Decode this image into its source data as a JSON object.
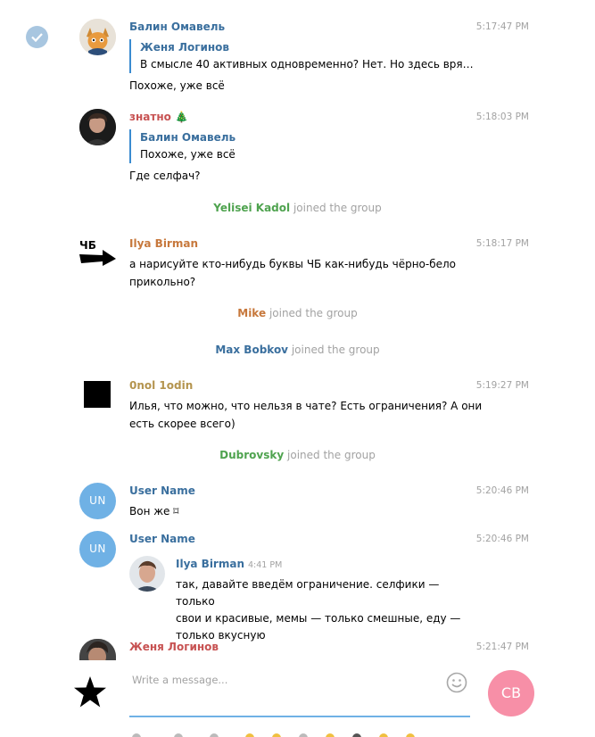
{
  "messages": [
    {
      "author": "Балин Омавель",
      "time": "5:17:47 PM",
      "reply_name": "Женя Логинов",
      "reply_text": "В смысле 40 активных одновременно? Нет. Но здесь вряд ...",
      "text": "Похоже, уже всё"
    },
    {
      "author": "знатно 🎄",
      "time": "5:18:03 PM",
      "reply_name": "Балин Омавель",
      "reply_text": "Похоже, уже всё",
      "text": "Где селфач?"
    },
    {
      "author": "Ilya Birman",
      "time": "5:18:17 PM",
      "text_line1": "а нарисуйте кто-нибудь буквы ЧБ как-нибудь чёрно-бело",
      "text_line2": "прикольно?",
      "avatar_text": "ЧБ"
    },
    {
      "author": "0nol 1odin",
      "time": "5:19:27 PM",
      "text_line1": "Илья, что можно, что нельзя в чате? Есть ограничения? А они",
      "text_line2": "есть скорее всего)"
    },
    {
      "author": "User Name",
      "time": "5:20:46 PM",
      "avatar_initials": "UN",
      "text": "Вон же ⌑"
    },
    {
      "author": "User Name",
      "time": "5:20:46 PM",
      "avatar_initials": "UN",
      "fwd_name": "Ilya Birman",
      "fwd_time": "4:41 PM",
      "fwd_line1": "так, давайте введём ограничение. селфики — только",
      "fwd_line2": "свои и красивые, мемы — только смешные, еду —",
      "fwd_line3": "только вкусную"
    },
    {
      "author": "Женя Логинов",
      "time": "5:21:47 PM"
    }
  ],
  "service": [
    {
      "name": "Yelisei Kadol",
      "text": "joined the group",
      "color": "#4fa34f"
    },
    {
      "name": "Mike",
      "text": "joined the group",
      "color": "#c7783c"
    },
    {
      "name": "Max Bobkov",
      "text": "joined the group",
      "color": "#3a6f9e"
    },
    {
      "name": "Dubrovsky",
      "text": "joined the group",
      "color": "#4fa34f"
    }
  ],
  "composer": {
    "placeholder": "Write a message...",
    "send_label": "CB"
  },
  "colors": {
    "accent": "#6fb1e5",
    "send": "#f78fa7",
    "author_blue": "#3a6f9e",
    "author_red": "#c75252",
    "author_orange": "#c7783c",
    "author_tan": "#b4944e"
  },
  "icons": [
    "check-icon",
    "emoji-icon",
    "star-icon",
    "arrow-icon"
  ]
}
